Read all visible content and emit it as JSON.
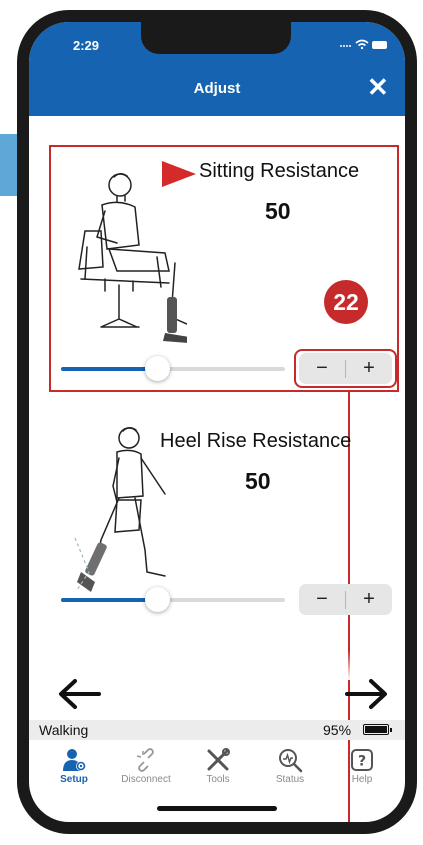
{
  "status_bar": {
    "time": "2:29"
  },
  "header": {
    "title": "Adjust",
    "close_icon": "close-icon"
  },
  "settings": [
    {
      "title": "Sitting Resistance",
      "value": "50",
      "slider_level": 0.43,
      "minus": "−",
      "plus": "+"
    },
    {
      "title": "Heel Rise Resistance",
      "value": "50",
      "slider_level": 0.43,
      "minus": "−",
      "plus": "+"
    }
  ],
  "annotation": {
    "badge": "22"
  },
  "navigation": {
    "prev_icon": "arrow-left-icon",
    "next_icon": "arrow-right-icon"
  },
  "status_strip": {
    "mode": "Walking",
    "battery": "95%"
  },
  "tabs": [
    {
      "label": "Setup",
      "icon": "user-gear-icon",
      "active": true
    },
    {
      "label": "Disconnect",
      "icon": "link-broken-icon",
      "active": false
    },
    {
      "label": "Tools",
      "icon": "tools-icon",
      "active": false
    },
    {
      "label": "Status",
      "icon": "status-magnifier-icon",
      "active": false
    },
    {
      "label": "Help",
      "icon": "help-icon",
      "active": false
    }
  ],
  "colors": {
    "header": "#1663b2",
    "annotation": "#c62a2a",
    "accent": "#1663b2"
  }
}
